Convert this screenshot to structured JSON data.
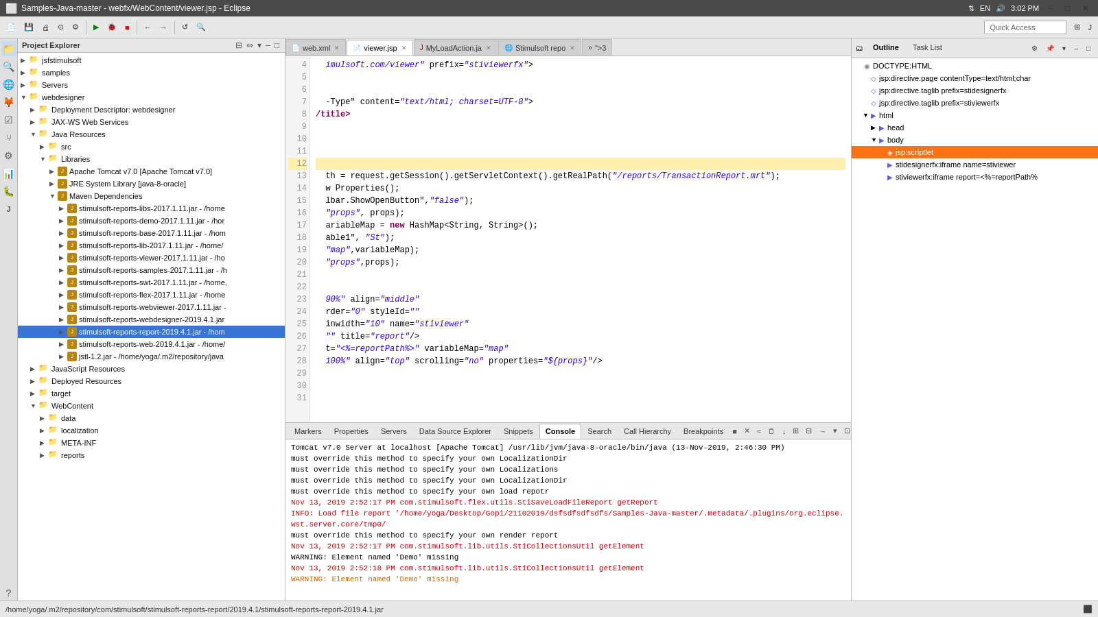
{
  "titlebar": {
    "title": "Samples-Java-master - webfx/WebContent/viewer.jsp - Eclipse",
    "time": "3:02 PM",
    "language": "EN"
  },
  "toolbar": {
    "quick_access_placeholder": "Quick Access"
  },
  "project_explorer": {
    "title": "Project Explorer",
    "items": [
      {
        "id": "jsfstimulsoft",
        "label": "jsfstimulsoft",
        "indent": 0,
        "type": "project",
        "arrow": "▶"
      },
      {
        "id": "samples",
        "label": "samples",
        "indent": 0,
        "type": "project",
        "arrow": "▶"
      },
      {
        "id": "servers",
        "label": "Servers",
        "indent": 0,
        "type": "project",
        "arrow": "▶"
      },
      {
        "id": "webdesigner",
        "label": "webdesigner",
        "indent": 0,
        "type": "project",
        "arrow": "▼"
      },
      {
        "id": "deployment",
        "label": "Deployment Descriptor: webdesigner",
        "indent": 1,
        "type": "folder",
        "arrow": "▶"
      },
      {
        "id": "jaxws",
        "label": "JAX-WS Web Services",
        "indent": 1,
        "type": "folder",
        "arrow": "▶"
      },
      {
        "id": "java-resources",
        "label": "Java Resources",
        "indent": 1,
        "type": "folder",
        "arrow": "▼"
      },
      {
        "id": "src",
        "label": "src",
        "indent": 2,
        "type": "folder",
        "arrow": "▶"
      },
      {
        "id": "libraries",
        "label": "Libraries",
        "indent": 2,
        "type": "folder",
        "arrow": "▼"
      },
      {
        "id": "tomcat",
        "label": "Apache Tomcat v7.0 [Apache Tomcat v7.0]",
        "indent": 3,
        "type": "jar",
        "arrow": "▶"
      },
      {
        "id": "jre",
        "label": "JRE System Library [java-8-oracle]",
        "indent": 3,
        "type": "jar",
        "arrow": "▶"
      },
      {
        "id": "maven-deps",
        "label": "Maven Dependencies",
        "indent": 3,
        "type": "jar",
        "arrow": "▼"
      },
      {
        "id": "jar1",
        "label": "stimulsoft-reports-libs-2017.1.11.jar - /home",
        "indent": 4,
        "type": "jar",
        "arrow": "▶"
      },
      {
        "id": "jar2",
        "label": "stimulsoft-reports-demo-2017.1.11.jar - /hor",
        "indent": 4,
        "type": "jar",
        "arrow": "▶"
      },
      {
        "id": "jar3",
        "label": "stimulsoft-reports-base-2017.1.11.jar - /hom",
        "indent": 4,
        "type": "jar",
        "arrow": "▶"
      },
      {
        "id": "jar4",
        "label": "stimulsoft-reports-lib-2017.1.11.jar - /home/",
        "indent": 4,
        "type": "jar",
        "arrow": "▶"
      },
      {
        "id": "jar5",
        "label": "stimulsoft-reports-viewer-2017.1.11.jar - /ho",
        "indent": 4,
        "type": "jar",
        "arrow": "▶"
      },
      {
        "id": "jar6",
        "label": "stimulsoft-reports-samples-2017.1.11.jar - /h",
        "indent": 4,
        "type": "jar",
        "arrow": "▶"
      },
      {
        "id": "jar7",
        "label": "stimulsoft-reports-swt-2017.1.11.jar - /home,",
        "indent": 4,
        "type": "jar",
        "arrow": "▶"
      },
      {
        "id": "jar8",
        "label": "stimulsoft-reports-flex-2017.1.11.jar - /home",
        "indent": 4,
        "type": "jar",
        "arrow": "▶"
      },
      {
        "id": "jar9",
        "label": "stimulsoft-reports-webviewer-2017.1.11.jar -",
        "indent": 4,
        "type": "jar",
        "arrow": "▶"
      },
      {
        "id": "jar10",
        "label": "stimulsoft-reports-webdesigner-2019.4.1.jar",
        "indent": 4,
        "type": "jar",
        "arrow": "▶"
      },
      {
        "id": "jar11",
        "label": "stimulsoft-reports-report-2019.4.1.jar - /hom",
        "indent": 4,
        "type": "jar",
        "arrow": "▶",
        "selected": true
      },
      {
        "id": "jar12",
        "label": "stimulsoft-reports-web-2019.4.1.jar - /home/",
        "indent": 4,
        "type": "jar",
        "arrow": "▶"
      },
      {
        "id": "jstl",
        "label": "jstl-1.2.jar - /home/yoga/.m2/repository/java",
        "indent": 4,
        "type": "jar",
        "arrow": "▶"
      },
      {
        "id": "js-resources",
        "label": "JavaScript Resources",
        "indent": 1,
        "type": "folder",
        "arrow": "▶"
      },
      {
        "id": "deployed",
        "label": "Deployed Resources",
        "indent": 1,
        "type": "folder",
        "arrow": "▶"
      },
      {
        "id": "target",
        "label": "target",
        "indent": 1,
        "type": "folder",
        "arrow": "▶"
      },
      {
        "id": "webcontent",
        "label": "WebContent",
        "indent": 1,
        "type": "folder",
        "arrow": "▼"
      },
      {
        "id": "data",
        "label": "data",
        "indent": 2,
        "type": "folder",
        "arrow": "▶"
      },
      {
        "id": "localization",
        "label": "localization",
        "indent": 2,
        "type": "folder",
        "arrow": "▶"
      },
      {
        "id": "meta-inf",
        "label": "META-INF",
        "indent": 2,
        "type": "folder",
        "arrow": "▶"
      },
      {
        "id": "reports",
        "label": "reports",
        "indent": 2,
        "type": "folder",
        "arrow": "▶"
      }
    ]
  },
  "editor": {
    "tabs": [
      {
        "id": "web-xml",
        "label": "web.xml",
        "dirty": false,
        "active": false,
        "icon": "xml"
      },
      {
        "id": "viewer-jsp",
        "label": "viewer.jsp",
        "dirty": false,
        "active": true,
        "icon": "jsp"
      },
      {
        "id": "myload",
        "label": "MyLoadAction.ja",
        "dirty": false,
        "active": false,
        "icon": "java"
      },
      {
        "id": "stimulsoft-repo",
        "label": "Stimulsoft repo",
        "dirty": false,
        "active": false,
        "icon": "repo"
      },
      {
        "id": "more",
        "label": "\">3",
        "dirty": false,
        "active": false,
        "icon": "more"
      }
    ],
    "lines": [
      {
        "num": 4,
        "content": "  imulsoft.com/viewer\" prefix=\"stiviewerfx\">",
        "highlight": false
      },
      {
        "num": 5,
        "content": "",
        "highlight": false
      },
      {
        "num": 6,
        "content": "",
        "highlight": false
      },
      {
        "num": 7,
        "content": "  -Type\" content=\"text/html; charset=UTF-8\">",
        "highlight": false
      },
      {
        "num": 8,
        "content": "/title>",
        "highlight": false
      },
      {
        "num": 9,
        "content": "",
        "highlight": false
      },
      {
        "num": 10,
        "content": "",
        "highlight": false
      },
      {
        "num": 11,
        "content": "",
        "highlight": false
      },
      {
        "num": 12,
        "content": "",
        "highlight": true
      },
      {
        "num": 13,
        "content": "  th = request.getSession().getServletContext().getRealPath(\"/reports/TransactionReport.mrt\");",
        "highlight": false
      },
      {
        "num": 14,
        "content": "  w Properties();",
        "highlight": false
      },
      {
        "num": 15,
        "content": "  lbar.ShowOpenButton\",\"false\");",
        "highlight": false
      },
      {
        "num": 16,
        "content": "  \"props\", props);",
        "highlight": false
      },
      {
        "num": 17,
        "content": "  ariableMap = new HashMap<String, String>();",
        "highlight": false
      },
      {
        "num": 18,
        "content": "  able1\", \"St\");",
        "highlight": false
      },
      {
        "num": 19,
        "content": "  \"map\",variableMap);",
        "highlight": false
      },
      {
        "num": 20,
        "content": "  \"props\",props);",
        "highlight": false
      },
      {
        "num": 21,
        "content": "",
        "highlight": false
      },
      {
        "num": 22,
        "content": "",
        "highlight": false
      },
      {
        "num": 23,
        "content": "  90%\" align=\"middle\"",
        "highlight": false
      },
      {
        "num": 24,
        "content": "  rder=\"0\" styleId=\"\"",
        "highlight": false
      },
      {
        "num": 25,
        "content": "  inwidth=\"10\" name=\"stiviewer\"",
        "highlight": false
      },
      {
        "num": 26,
        "content": "  \"\" title=\"report\"/>",
        "highlight": false
      },
      {
        "num": 27,
        "content": "  t=\"<%=reportPath%>\" variableMap=\"map\"",
        "highlight": false
      },
      {
        "num": 28,
        "content": "  100%\" align=\"top\" scrolling=\"no\" properties=\"${props}\"/>",
        "highlight": false
      },
      {
        "num": 29,
        "content": "",
        "highlight": false
      },
      {
        "num": 30,
        "content": "",
        "highlight": false
      },
      {
        "num": 31,
        "content": "",
        "highlight": false
      }
    ]
  },
  "outline": {
    "title": "Outline",
    "task_list_label": "Task List",
    "items": [
      {
        "id": "doctype",
        "label": "DOCTYPE:HTML",
        "indent": 0,
        "arrow": "",
        "icon": "◉",
        "type": "doctype"
      },
      {
        "id": "page-directive",
        "label": "jsp:directive.page contentType=text/html;char",
        "indent": 1,
        "arrow": "",
        "icon": "◇",
        "type": "directive"
      },
      {
        "id": "taglib1",
        "label": "jsp:directive.taglib prefix=stidesignerfx",
        "indent": 1,
        "arrow": "",
        "icon": "◇",
        "type": "directive"
      },
      {
        "id": "taglib2",
        "label": "jsp:directive.taglib prefix=stiviewerfx",
        "indent": 1,
        "arrow": "",
        "icon": "◇",
        "type": "directive"
      },
      {
        "id": "html",
        "label": "html",
        "indent": 1,
        "arrow": "▼",
        "icon": "◉",
        "type": "element"
      },
      {
        "id": "head",
        "label": "head",
        "indent": 2,
        "arrow": "▶",
        "icon": "▶",
        "type": "element"
      },
      {
        "id": "body",
        "label": "body",
        "indent": 2,
        "arrow": "▼",
        "icon": "▼",
        "type": "element"
      },
      {
        "id": "scriptlet",
        "label": "jsp:scriptlet",
        "indent": 3,
        "arrow": "",
        "icon": "◈",
        "type": "selected"
      },
      {
        "id": "stidesigner",
        "label": "stidesignerfx:iframe name=stiviewer",
        "indent": 3,
        "arrow": "",
        "icon": "◇",
        "type": "element"
      },
      {
        "id": "stiviewer",
        "label": "stiviewerfx:iframe report=<%=reportPath%",
        "indent": 3,
        "arrow": "",
        "icon": "◇",
        "type": "element"
      }
    ]
  },
  "bottom": {
    "tabs": [
      {
        "id": "markers",
        "label": "Markers",
        "active": false
      },
      {
        "id": "properties",
        "label": "Properties",
        "active": false
      },
      {
        "id": "servers",
        "label": "Servers",
        "active": false
      },
      {
        "id": "datasource",
        "label": "Data Source Explorer",
        "active": false
      },
      {
        "id": "snippets",
        "label": "Snippets",
        "active": false
      },
      {
        "id": "console",
        "label": "Console",
        "active": true
      },
      {
        "id": "search",
        "label": "Search",
        "active": false
      },
      {
        "id": "callhierarchy",
        "label": "Call Hierarchy",
        "active": false
      },
      {
        "id": "breakpoints",
        "label": "Breakpoints",
        "active": false
      }
    ],
    "console_lines": [
      {
        "text": "Tomcat v7.0 Server at localhost [Apache Tomcat] /usr/lib/jvm/java-8-oracle/bin/java (13-Nov-2019, 2:46:30 PM)",
        "type": "normal"
      },
      {
        "text": "must override this method to specify your own LocalizationDir",
        "type": "normal"
      },
      {
        "text": "must override this method to specify your own Localizations",
        "type": "normal"
      },
      {
        "text": "must override this method to specify your own LocalizationDir",
        "type": "normal"
      },
      {
        "text": "must override this method to specify your own load repotr",
        "type": "normal"
      },
      {
        "text": "Nov 13, 2019 2:52:17 PM com.stimulsoft.flex.utils.StiSaveLoadFileReport getReport",
        "type": "red"
      },
      {
        "text": "INFO: Load file report '/home/yoga/Desktop/Gopi/21102019/dsfsdfsdfsdfs/Samples-Java-master/.metadata/.plugins/org.eclipse.wst.server.core/tmp0/",
        "type": "red"
      },
      {
        "text": "must override this method to specify your own render report",
        "type": "normal"
      },
      {
        "text": "Nov 13, 2019 2:52:17 PM com.stimulsoft.lib.utils.StiCollectionsUtil getElement",
        "type": "red"
      },
      {
        "text": "WARNING: Element named 'Demo' missing",
        "type": "normal"
      },
      {
        "text": "Nov 13, 2019 2:52:18 PM com.stimulsoft.lib.utils.StiCollectionsUtil getElement",
        "type": "red"
      },
      {
        "text": "WARNING: Element named 'Demo' missing",
        "type": "orange"
      }
    ]
  },
  "statusbar": {
    "path": "/home/yoga/.m2/repository/com/stimulsoft/stimulsoft-reports-report/2019.4.1/stimulsoft-reports-report-2019.4.1.jar",
    "right": "⬛"
  }
}
